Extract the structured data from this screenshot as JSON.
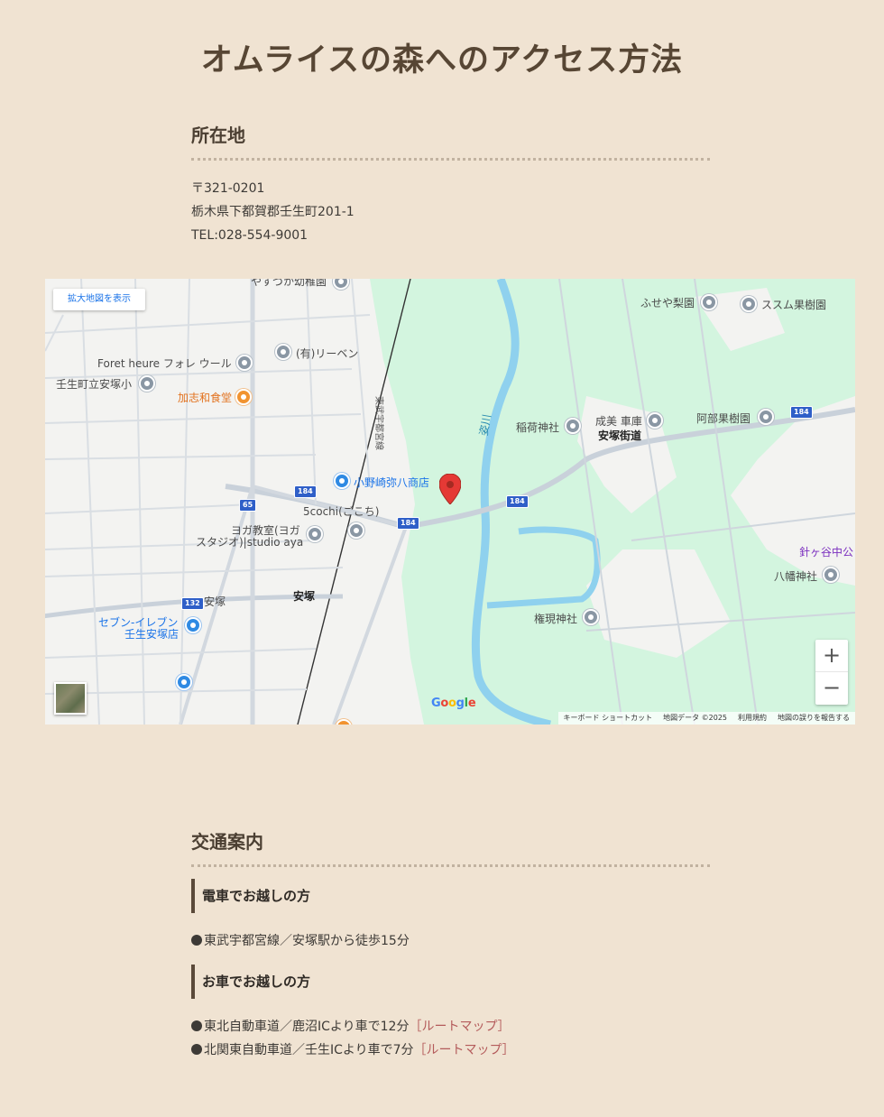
{
  "page": {
    "title": "オムライスの森へのアクセス方法"
  },
  "location": {
    "heading": "所在地",
    "postal": "〒321-0201",
    "address": "栃木県下都賀郡壬生町201-1",
    "tel": "TEL:028-554-9001"
  },
  "map": {
    "enlarge_label": "拡大地図を表示",
    "zoom_in": "+",
    "zoom_out": "−",
    "google_logo": "Google",
    "attribution": {
      "shortcuts": "キーボード ショートカット",
      "map_data": "地図データ ©2025",
      "terms": "利用規約",
      "report": "地図の誤りを報告する"
    },
    "labels": {
      "kindergarten": "やすづか幼稚園",
      "fuseya": "ふせや梨園",
      "susumu": "ススム果樹園",
      "foret": "Foret heure フォレ ウール",
      "riben": "(有)リーベン",
      "school": "壬生町立安塚小",
      "kashiwa": "加志和食堂",
      "inari": "稲荷神社",
      "narumi": "成美 車庫",
      "abe": "阿部果樹園",
      "yasuzuka_kaido": "安塚街道",
      "line_name": "東武宇都宮線",
      "river": "姿川",
      "onozaki": "小野崎弥八商店",
      "cochi": "5cochi(ごこち)",
      "yoga1": "ヨガ教室(ヨガ",
      "yoga2": "スタジオ)|studio aya",
      "harigaya": "針ヶ谷中公",
      "hachiman": "八幡神社",
      "yasuzuka": "安塚",
      "station": "安塚",
      "seven1": "セブン-イレブン",
      "seven2": "壬生安塚店",
      "gongen": "権現神社",
      "r184a": "184",
      "r184b": "184",
      "r184c": "184",
      "r184d": "184",
      "r65": "65",
      "r132": "132"
    }
  },
  "access": {
    "heading": "交通案内",
    "train": {
      "heading": "電車でお越しの方",
      "line1": "東武宇都宮線／安塚駅から徒歩15分"
    },
    "car": {
      "heading": "お車でお越しの方",
      "line1": "東北自動車道／鹿沼ICより車で12分",
      "line1_link": "［ルートマップ］",
      "line2": "北関東自動車道／壬生ICより車で7分",
      "line2_link": "［ルートマップ］"
    }
  }
}
